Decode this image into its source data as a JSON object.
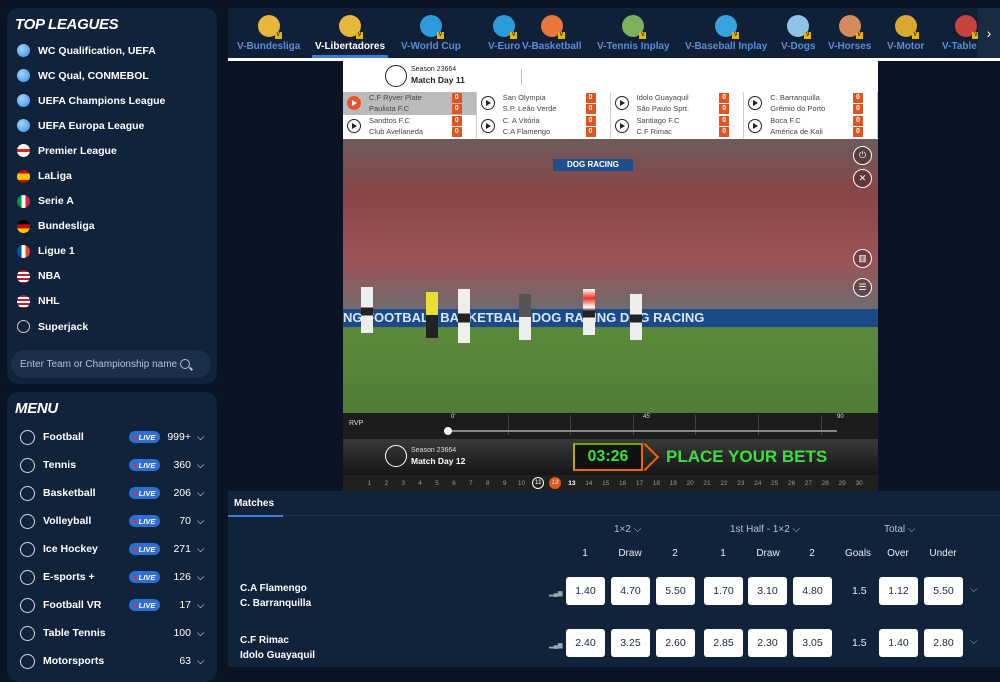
{
  "top_leagues": {
    "title": "TOP LEAGUES",
    "items": [
      {
        "label": "WC Qualification, UEFA",
        "icon": "globe-icon"
      },
      {
        "label": "WC Qual, CONMEBOL",
        "icon": "globe-icon"
      },
      {
        "label": "UEFA Champions League",
        "icon": "globe-icon"
      },
      {
        "label": "UEFA Europa League",
        "icon": "globe-icon"
      },
      {
        "label": "Premier League",
        "icon": "england-flag-icon"
      },
      {
        "label": "LaLiga",
        "icon": "spain-flag-icon"
      },
      {
        "label": "Serie A",
        "icon": "italy-flag-icon"
      },
      {
        "label": "Bundesliga",
        "icon": "germany-flag-icon"
      },
      {
        "label": "Ligue 1",
        "icon": "france-flag-icon"
      },
      {
        "label": "NBA",
        "icon": "usa-flag-icon"
      },
      {
        "label": "NHL",
        "icon": "usa-flag-icon"
      },
      {
        "label": "Superjack",
        "icon": "superjack-icon"
      }
    ],
    "search_placeholder": "Enter Team or Championship name"
  },
  "menu": {
    "title": "MENU",
    "live_label": "LIVE",
    "items": [
      {
        "label": "Football",
        "live": true,
        "count": "999+"
      },
      {
        "label": "Tennis",
        "live": true,
        "count": "360"
      },
      {
        "label": "Basketball",
        "live": true,
        "count": "206"
      },
      {
        "label": "Volleyball",
        "live": true,
        "count": "70"
      },
      {
        "label": "Ice Hockey",
        "live": true,
        "count": "271"
      },
      {
        "label": "E-sports +",
        "live": true,
        "count": "126"
      },
      {
        "label": "Football VR",
        "live": true,
        "count": "17"
      },
      {
        "label": "Table Tennis",
        "live": false,
        "count": "100"
      },
      {
        "label": "Motorsports",
        "live": false,
        "count": "63"
      }
    ]
  },
  "virtual_tabs": [
    {
      "label": "V-Bundesliga",
      "active": false
    },
    {
      "label": "V-Libertadores",
      "active": true
    },
    {
      "label": "V-World Cup",
      "active": false
    },
    {
      "label": "V-Euro",
      "active": false
    },
    {
      "label": "V-Basketball",
      "active": false
    },
    {
      "label": "V-Tennis Inplay",
      "active": false
    },
    {
      "label": "V-Baseball Inplay",
      "active": false
    },
    {
      "label": "V-Dogs",
      "active": false
    },
    {
      "label": "V-Horses",
      "active": false
    },
    {
      "label": "V-Motor",
      "active": false
    },
    {
      "label": "V-Table Te",
      "active": false
    }
  ],
  "video": {
    "header": {
      "season": "Season 23664",
      "match_day": "Match Day 11"
    },
    "matches": [
      {
        "home": "C.F Ryver Plate",
        "away": "Paulista F.C",
        "home_score": "0",
        "away_score": "0",
        "playing": true
      },
      {
        "home": "San Olympia",
        "away": "S.P. Leão Verde",
        "home_score": "0",
        "away_score": "0",
        "playing": false
      },
      {
        "home": "Idolo Guayaquil",
        "away": "São Paulo Sprt.",
        "home_score": "0",
        "away_score": "0",
        "playing": false
      },
      {
        "home": "C. Barranquilla",
        "away": "Grêmio do Porto",
        "home_score": "0",
        "away_score": "0",
        "playing": false
      },
      {
        "home": "Sandtos F.C",
        "away": "Club Avellaneda",
        "home_score": "0",
        "away_score": "0",
        "playing": false
      },
      {
        "home": "C. A Vitória",
        "away": "C.A Flamengo",
        "home_score": "0",
        "away_score": "0",
        "playing": false
      },
      {
        "home": "Santiago F.C",
        "away": "C.F Rimac",
        "home_score": "0",
        "away_score": "0",
        "playing": false
      },
      {
        "home": "Boca F.C",
        "away": "América de Kali",
        "home_score": "0",
        "away_score": "0",
        "playing": false
      }
    ],
    "banner_top": "DOG RACING",
    "adboard": "NG  FOOTBALL   BASKETBALL   DOG RACING   DOG RACING",
    "timeline": {
      "label": "RVP",
      "marks": [
        "0'",
        "45'",
        "90"
      ],
      "progress": 0
    },
    "bet_header": {
      "season": "Season 23664",
      "match_day": "Match Day 12",
      "timer": "03:26",
      "message": "PLACE YOUR BETS"
    },
    "match_days": [
      "1",
      "2",
      "3",
      "4",
      "5",
      "6",
      "7",
      "8",
      "9",
      "10",
      "11",
      "12",
      "13",
      "14",
      "15",
      "16",
      "17",
      "18",
      "19",
      "20",
      "21",
      "22",
      "23",
      "24",
      "25",
      "26",
      "27",
      "28",
      "29",
      "30"
    ],
    "previous_day": "11",
    "current_day": "12",
    "next_day": "13"
  },
  "matches": {
    "tab": "Matches",
    "groups": [
      {
        "label": "1×2"
      },
      {
        "label": "1st Half - 1×2"
      },
      {
        "label": "Total"
      }
    ],
    "columns": [
      "1",
      "Draw",
      "2",
      "1",
      "Draw",
      "2",
      "Goals",
      "Over",
      "Under"
    ],
    "rows": [
      {
        "home": "C.A Flamengo",
        "away": "C. Barranquilla",
        "odds": [
          "1.40",
          "4.70",
          "5.50",
          "1.70",
          "3.10",
          "4.80"
        ],
        "goals": "1.5",
        "over": "1.12",
        "under": "5.50"
      },
      {
        "home": "C.F Rimac",
        "away": "Idolo Guayaquil",
        "odds": [
          "2.40",
          "3.25",
          "2.60",
          "2.85",
          "2.30",
          "3.05"
        ],
        "goals": "1.5",
        "over": "1.40",
        "under": "2.80"
      }
    ]
  }
}
